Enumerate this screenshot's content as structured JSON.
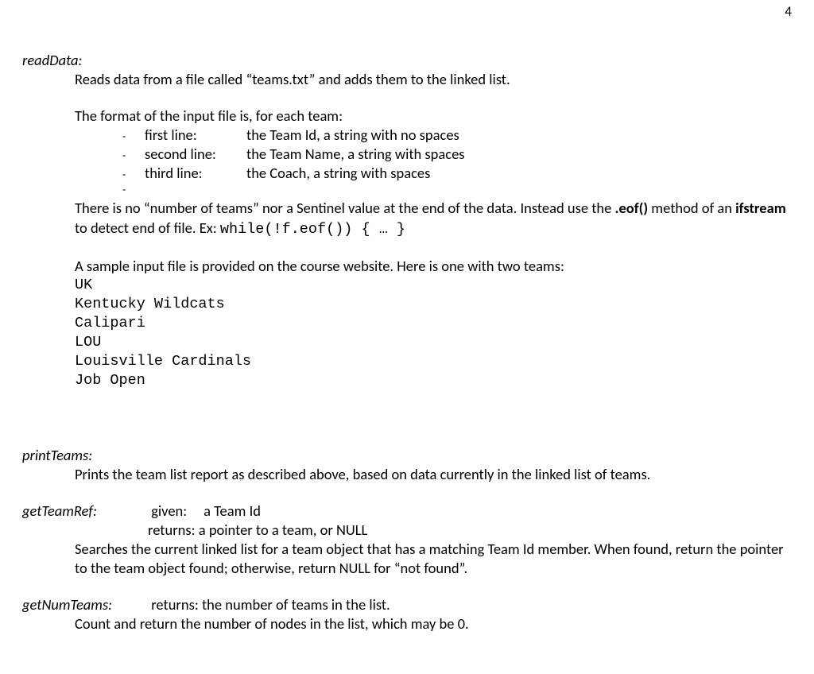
{
  "pageNumber": "4",
  "readData": {
    "title": "readData:",
    "desc": "Reads data from a file called “teams.txt” and adds them to the linked list.",
    "formatIntro": "The format of the input file is, for each team:",
    "lines": [
      {
        "label": "first line:",
        "desc": "the Team Id, a string with no spaces"
      },
      {
        "label": "second line:",
        "desc": "the Team Name, a string with spaces"
      },
      {
        "label": "third line:",
        "desc": "the Coach, a string with spaces"
      }
    ],
    "sentinel_pre": "There is no “number of teams” nor a Sentinel value at the end of the data. Instead use the ",
    "sentinel_bold1": ".eof()",
    "sentinel_mid": " method of an ",
    "sentinel_bold2": "ifstream",
    "sentinel_after": " to detect end of file. Ex:   ",
    "sentinel_code": "while(!f.eof()) { … }",
    "sampleIntro": "A sample input file is provided on the course website. Here is one with two teams:",
    "sample": [
      "UK",
      "Kentucky Wildcats",
      "Calipari",
      "LOU",
      "Louisville Cardinals",
      "Job Open"
    ]
  },
  "printTeams": {
    "title": "printTeams:",
    "desc": "Prints the team list report as described above, based on data currently in the linked list of teams."
  },
  "getTeamRef": {
    "title": "getTeamRef:",
    "givenLabel": "given:",
    "givenValue": "a Team Id",
    "returnsLabel": "returns:",
    "returnsValue": "a pointer to a team, or NULL",
    "body": "Searches the current linked list for a team object that has a matching Team Id member. When found, return the pointer to the team object found; otherwise, return NULL for “not found”."
  },
  "getNumTeams": {
    "title": "getNumTeams:",
    "returns": "returns: the number of teams in the list.",
    "body": "Count and return the number of nodes in the list, which may be 0."
  }
}
